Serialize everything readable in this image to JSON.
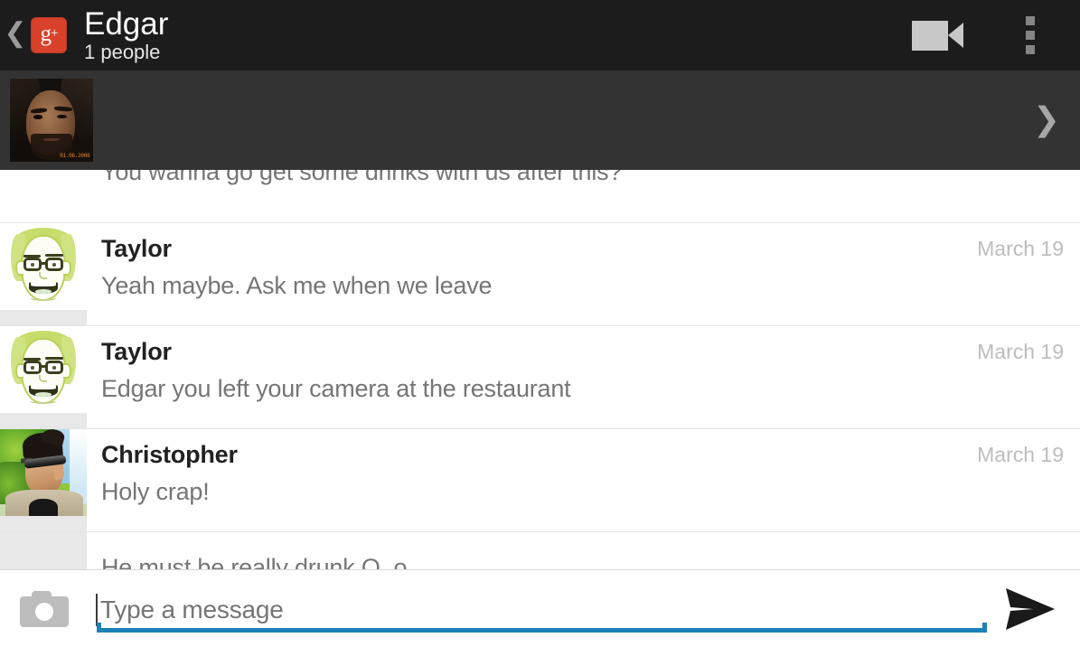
{
  "header": {
    "back_icon": "back-chevron-icon",
    "app_logo": "google-plus-logo",
    "logo_text": "g",
    "logo_plus": "+",
    "title": "Edgar",
    "subtitle": "1 people",
    "video_call_icon": "video-camera-icon",
    "overflow_icon": "overflow-menu-icon"
  },
  "participant_strip": {
    "avatars": [
      {
        "name": "participant-avatar-edgar",
        "kind": "photo-dark-portrait",
        "stamp": "01.06.2008"
      }
    ],
    "expand_icon": "chevron-right-icon"
  },
  "messages": [
    {
      "sender": "",
      "text": "You wanna go get some drinks with us after this?",
      "date": "",
      "avatar": "none",
      "partial": "top"
    },
    {
      "sender": "Taylor",
      "text": "Yeah maybe. Ask me when we leave",
      "date": "March 19",
      "avatar": "cartoon-face",
      "partial": "none"
    },
    {
      "sender": "Taylor",
      "text": "Edgar you left your camera at the restaurant",
      "date": "March 19",
      "avatar": "cartoon-face",
      "partial": "none"
    },
    {
      "sender": "Christopher",
      "text": "Holy crap!",
      "date": "March 19",
      "avatar": "photo-man-sunglasses",
      "partial": "none"
    },
    {
      "sender": "",
      "text": "He must be really drunk O_o",
      "date": "",
      "avatar": "none",
      "partial": "bottom"
    }
  ],
  "composer": {
    "camera_icon": "camera-icon",
    "input_value": "",
    "input_placeholder": "Type a message",
    "send_icon": "send-paper-plane-icon"
  },
  "colors": {
    "header_bg": "#1c1c1c",
    "strip_bg": "#333333",
    "accent_blue": "#1b81b8",
    "logo_red": "#d9412b",
    "gutter_gray": "#e8e8e8",
    "name_text": "#212121",
    "message_text": "#757575",
    "date_text": "#bdbdbd"
  }
}
